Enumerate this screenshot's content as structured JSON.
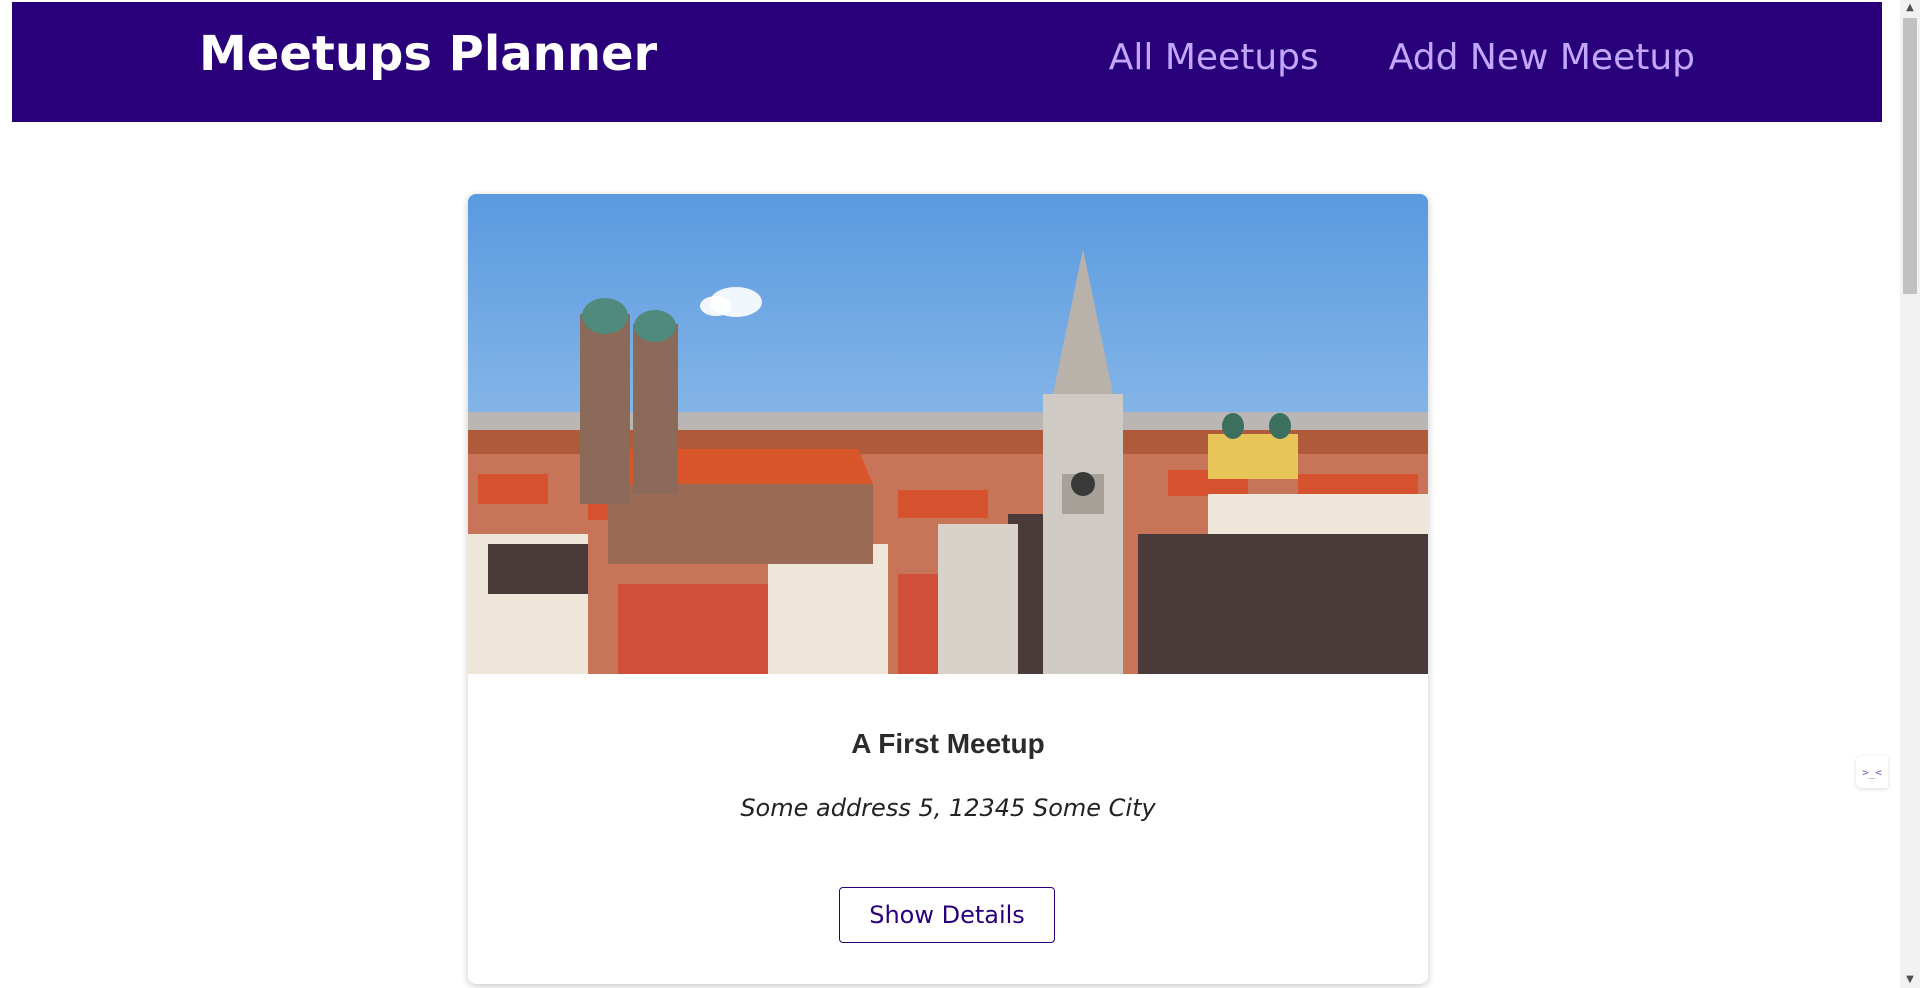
{
  "header": {
    "brand": "Meetups Planner",
    "nav": [
      {
        "label": "All Meetups"
      },
      {
        "label": "Add New Meetup"
      }
    ]
  },
  "meetup": {
    "title": "A First Meetup",
    "address": "Some address 5, 12345 Some City",
    "button_label": "Show Details",
    "image_icon": "city-photo-munich-icon"
  },
  "colors": {
    "header_bg": "#2a007a",
    "nav_link": "#c0a8ff",
    "button_border": "#2a007a"
  },
  "extension": {
    "icon": "extension-widget-icon",
    "glyph": ">_<"
  }
}
